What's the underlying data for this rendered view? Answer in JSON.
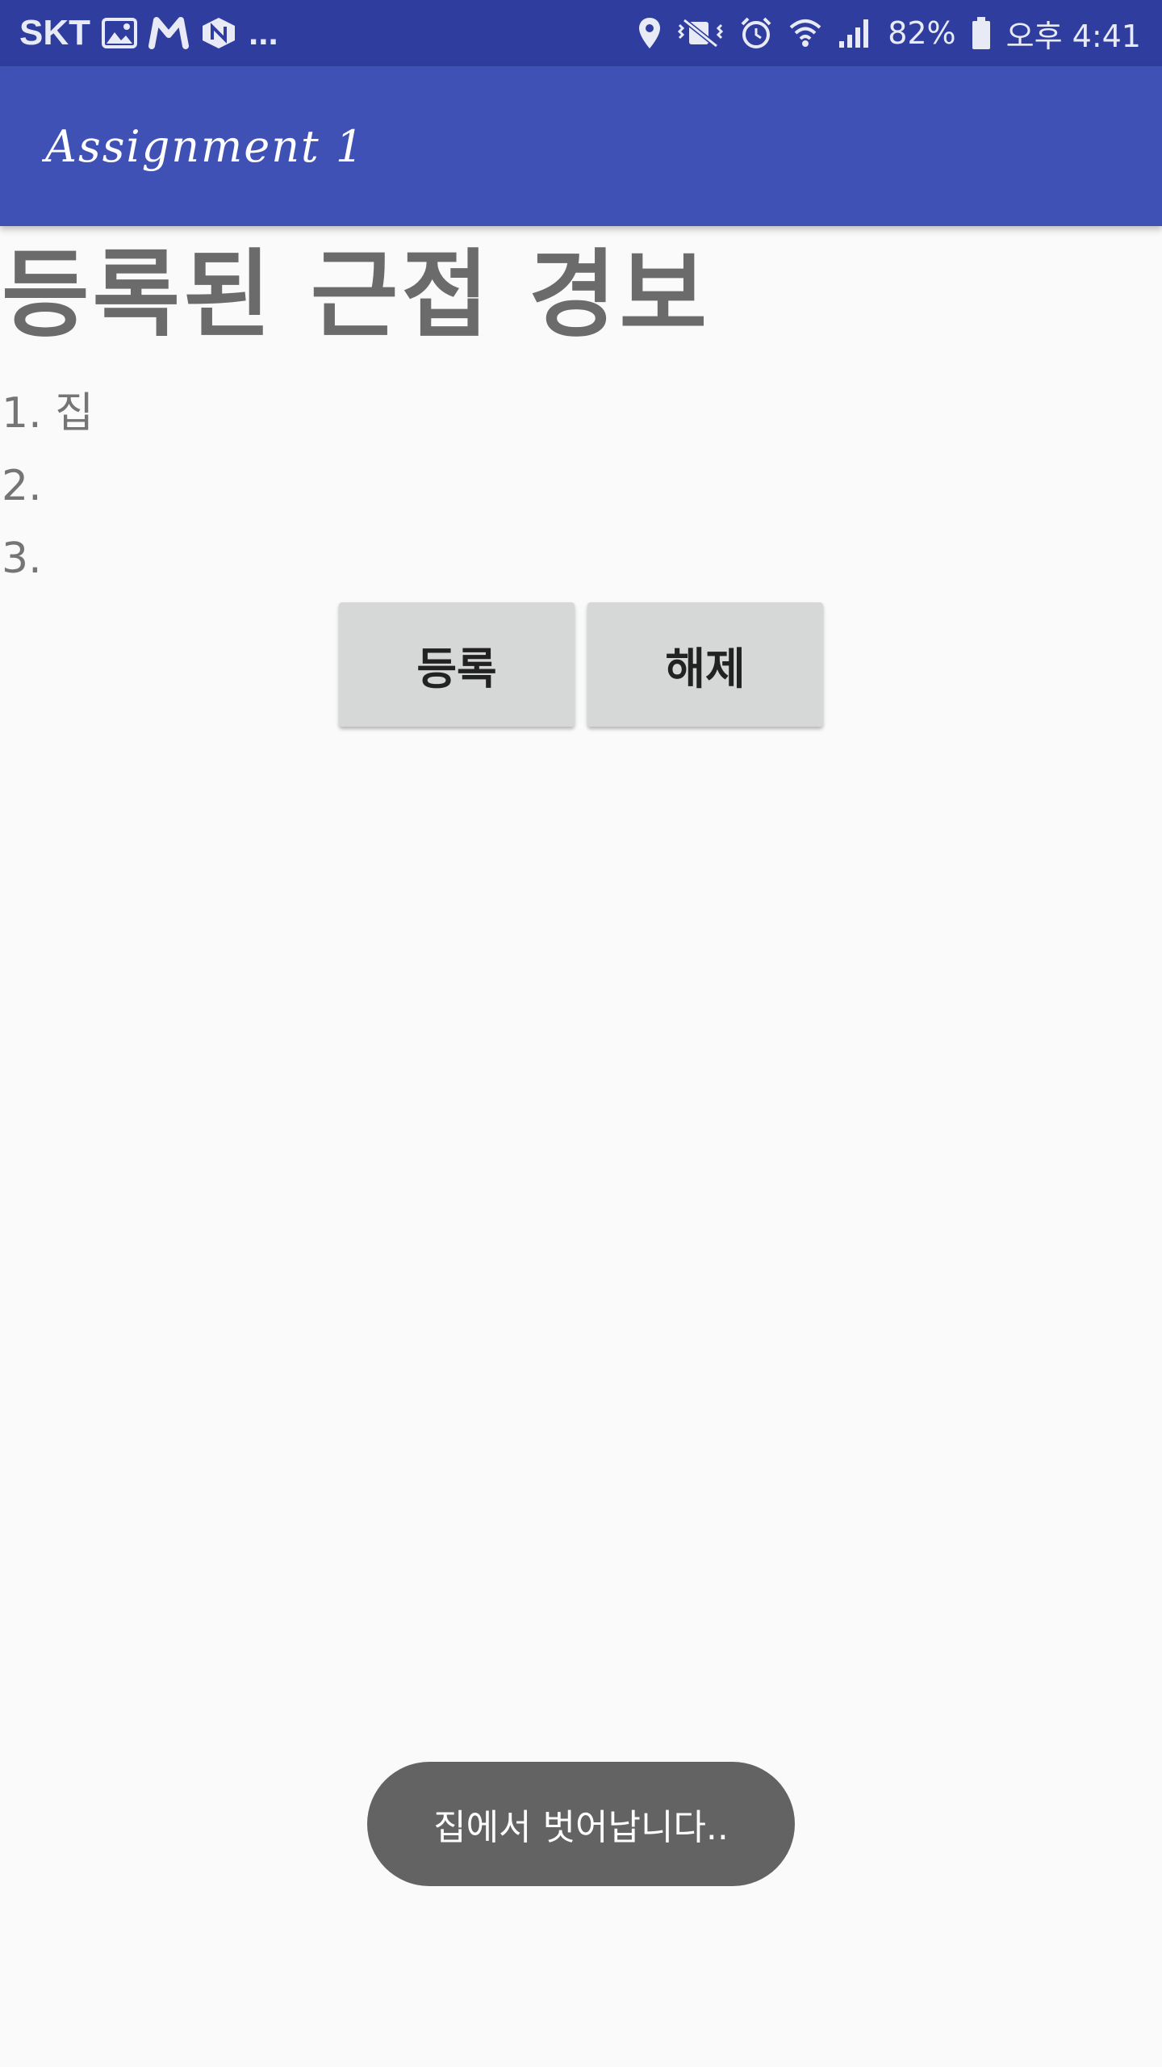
{
  "status_bar": {
    "carrier": "SKT",
    "left_icons": [
      "image-icon",
      "m-app-icon",
      "n-app-icon"
    ],
    "more": "...",
    "right_icons": [
      "location-icon",
      "vibrate-mute-icon",
      "alarm-icon",
      "wifi-icon",
      "signal-icon",
      "battery-icon"
    ],
    "battery_percent": "82%",
    "time": "오후 4:41"
  },
  "app_bar": {
    "title": "Assignment 1"
  },
  "main": {
    "heading": "등록된 근접 경보",
    "items": [
      "1. 집",
      "2.",
      "3."
    ],
    "buttons": {
      "register": "등록",
      "release": "해제"
    }
  },
  "toast": {
    "message": "집에서 벗어납니다.."
  },
  "colors": {
    "status_bar": "#2f3e9e",
    "app_bar": "#3f51b5",
    "background": "#fafafa",
    "button": "#d6d7d7",
    "toast": "#636363"
  }
}
